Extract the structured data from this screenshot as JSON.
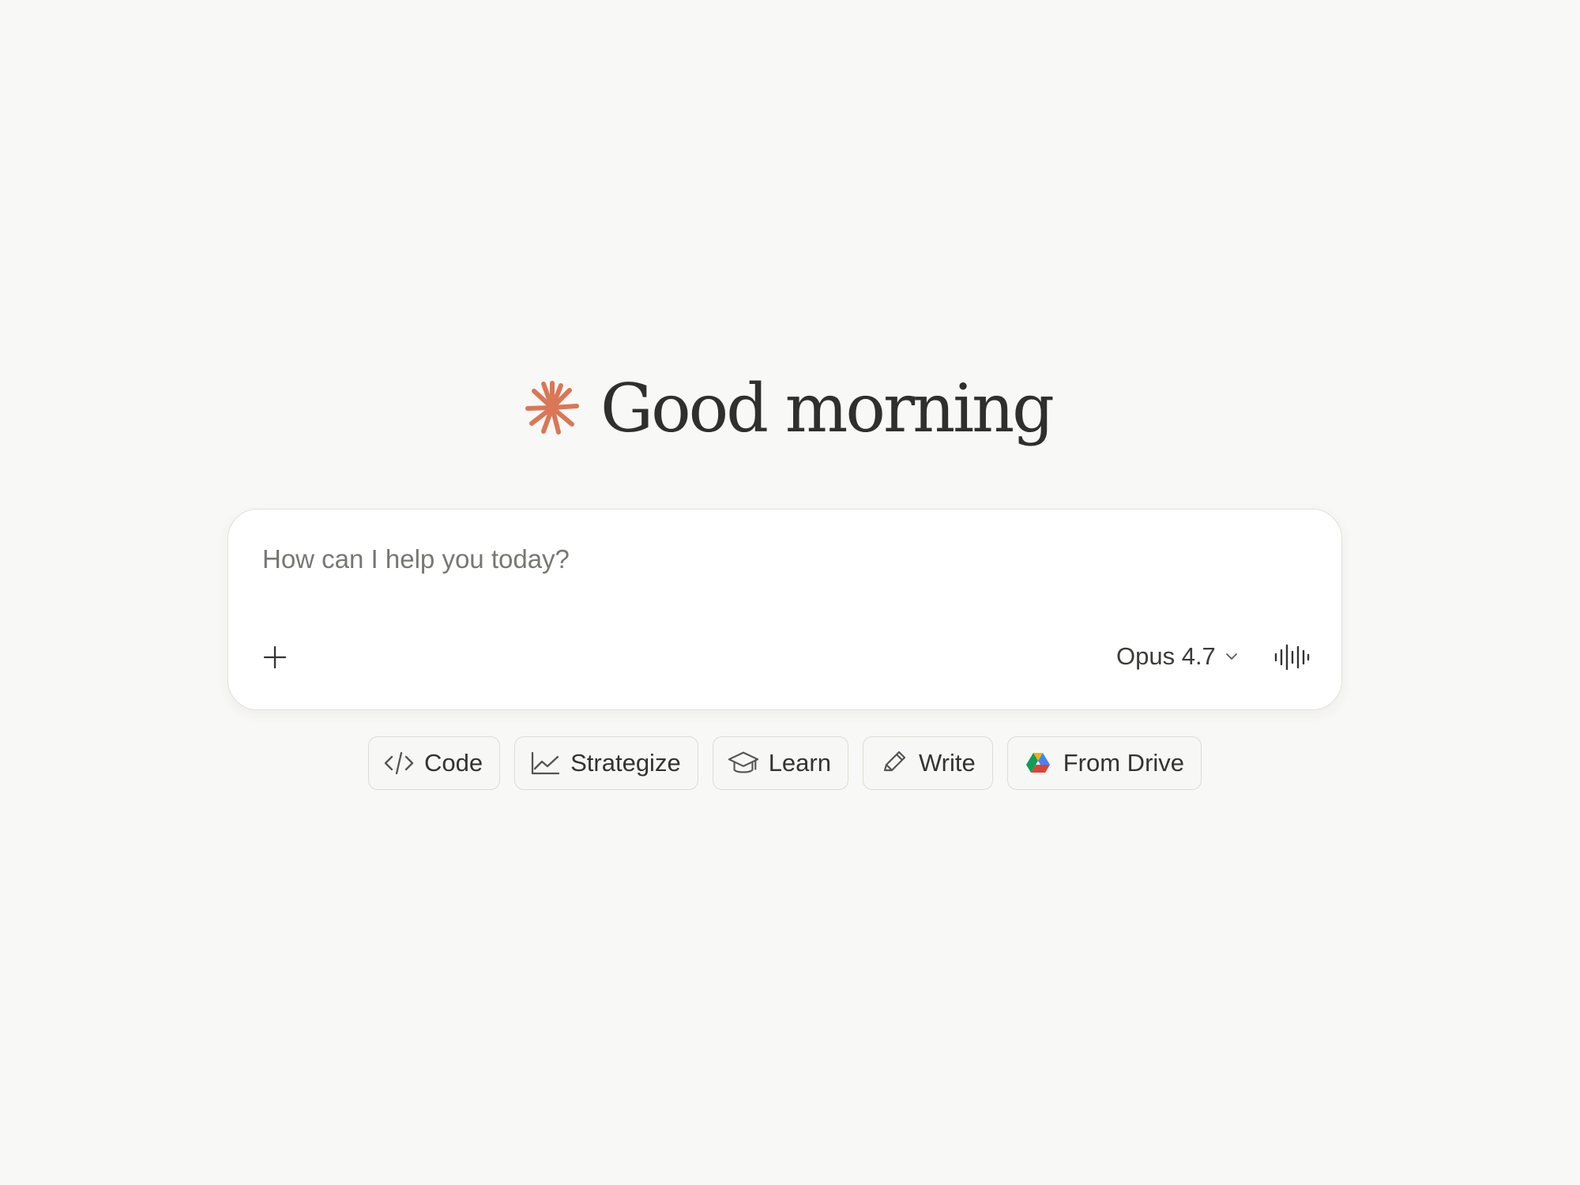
{
  "greeting": {
    "text": "Good morning",
    "icon": "asterisk-spark-icon",
    "accent_color": "#d97757"
  },
  "composer": {
    "placeholder": "How can I help you today?",
    "value": "",
    "add_icon": "plus-icon",
    "model": {
      "label": "Opus 4.7",
      "icon": "chevron-down-icon"
    },
    "voice_icon": "waveform-icon"
  },
  "suggestions": [
    {
      "label": "Code",
      "icon": "code-icon"
    },
    {
      "label": "Strategize",
      "icon": "chart-line-icon"
    },
    {
      "label": "Learn",
      "icon": "graduation-cap-icon"
    },
    {
      "label": "Write",
      "icon": "pencil-icon"
    },
    {
      "label": "From Drive",
      "icon": "google-drive-icon"
    }
  ],
  "colors": {
    "background": "#f8f8f6",
    "surface": "#ffffff",
    "text": "#2f2f2d",
    "muted_text": "#777773",
    "border": "#dfdcd5",
    "drive_blue": "#4285f4",
    "drive_green": "#0f9d58",
    "drive_yellow": "#f4b400",
    "drive_red": "#db4437"
  }
}
